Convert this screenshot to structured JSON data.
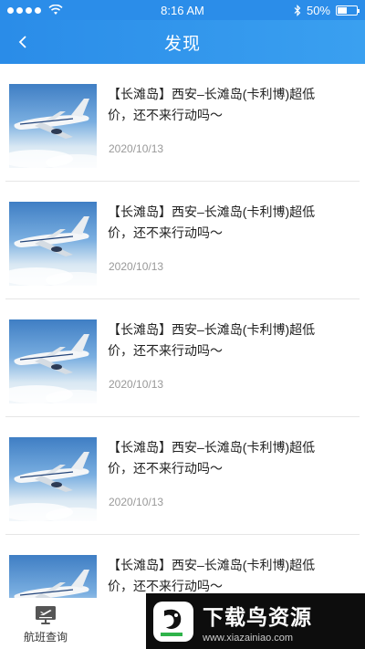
{
  "status_bar": {
    "time": "8:16 AM",
    "battery": "50%",
    "battery_level": 0.5
  },
  "nav": {
    "title": "发现",
    "back_icon": "chevron-left-icon"
  },
  "feed": {
    "items": [
      {
        "title": "【长滩岛】西安–长滩岛(卡利博)超低价，还不来行动吗～",
        "date": "2020/10/13"
      },
      {
        "title": "【长滩岛】西安–长滩岛(卡利博)超低价，还不来行动吗～",
        "date": "2020/10/13"
      },
      {
        "title": "【长滩岛】西安–长滩岛(卡利博)超低价，还不来行动吗～",
        "date": "2020/10/13"
      },
      {
        "title": "【长滩岛】西安–长滩岛(卡利博)超低价，还不来行动吗～",
        "date": "2020/10/13"
      },
      {
        "title": "【长滩岛】西安–长滩岛(卡利博)超低价，还不来行动吗～",
        "date": ""
      }
    ]
  },
  "tab_bar": {
    "flight_query_label": "航班查询",
    "flight_query_icon": "departure-board-icon"
  },
  "watermark": {
    "title": "下载鸟资源",
    "url": "www.xiazainiao.com"
  },
  "colors": {
    "primary": "#2b8de9",
    "date_gray": "#999999"
  }
}
